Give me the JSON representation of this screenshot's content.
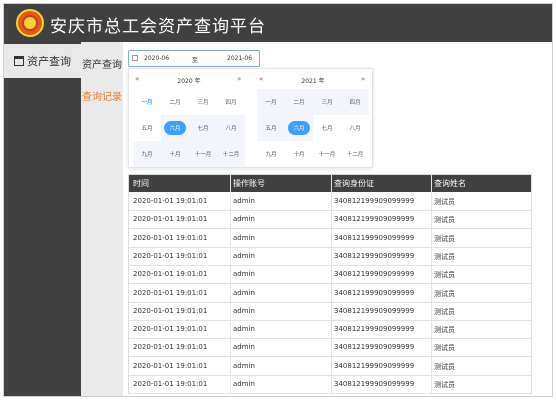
{
  "app": {
    "title": "安庆市总工会资产查询平台"
  },
  "sidebar": {
    "items": [
      {
        "label": "资产查询"
      }
    ]
  },
  "subnav": {
    "items": [
      {
        "label": "资产查询"
      },
      {
        "label": "查询记录"
      }
    ]
  },
  "date_range": {
    "start": "2020-06",
    "separator": "至",
    "end": "2021-06"
  },
  "picker": {
    "left": {
      "year": "2020 年",
      "prev": "«",
      "next": "»"
    },
    "right": {
      "year": "2021 年",
      "prev": "«",
      "next": "»"
    },
    "months": [
      "一月",
      "二月",
      "三月",
      "四月",
      "五月",
      "六月",
      "七月",
      "八月",
      "九月",
      "十月",
      "十一月",
      "十二月"
    ]
  },
  "table": {
    "headers": [
      "时间",
      "操作账号",
      "查询身份证",
      "查询姓名"
    ],
    "rows": [
      [
        "2020-01-01 19:01:01",
        "admin",
        "340812199909099999",
        "测试员"
      ],
      [
        "2020-01-01 19:01:01",
        "admin",
        "340812199909099999",
        "测试员"
      ],
      [
        "2020-01-01 19:01:01",
        "admin",
        "340812199909099999",
        "测试员"
      ],
      [
        "2020-01-01 19:01:01",
        "admin",
        "340812199909099999",
        "测试员"
      ],
      [
        "2020-01-01 19:01:01",
        "admin",
        "340812199909099999",
        "测试员"
      ],
      [
        "2020-01-01 19:01:01",
        "admin",
        "340812199909099999",
        "测试员"
      ],
      [
        "2020-01-01 19:01:01",
        "admin",
        "340812199909099999",
        "测试员"
      ],
      [
        "2020-01-01 19:01:01",
        "admin",
        "340812199909099999",
        "测试员"
      ],
      [
        "2020-01-01 19:01:01",
        "admin",
        "340812199909099999",
        "测试员"
      ],
      [
        "2020-01-01 19:01:01",
        "admin",
        "340812199909099999",
        "测试员"
      ],
      [
        "2020-01-01 19:01:01",
        "admin",
        "340812199909099999",
        "测试员"
      ]
    ]
  },
  "colors": {
    "header_bg": "#404040",
    "accent": "#409eff",
    "active_link": "#e8792a"
  }
}
